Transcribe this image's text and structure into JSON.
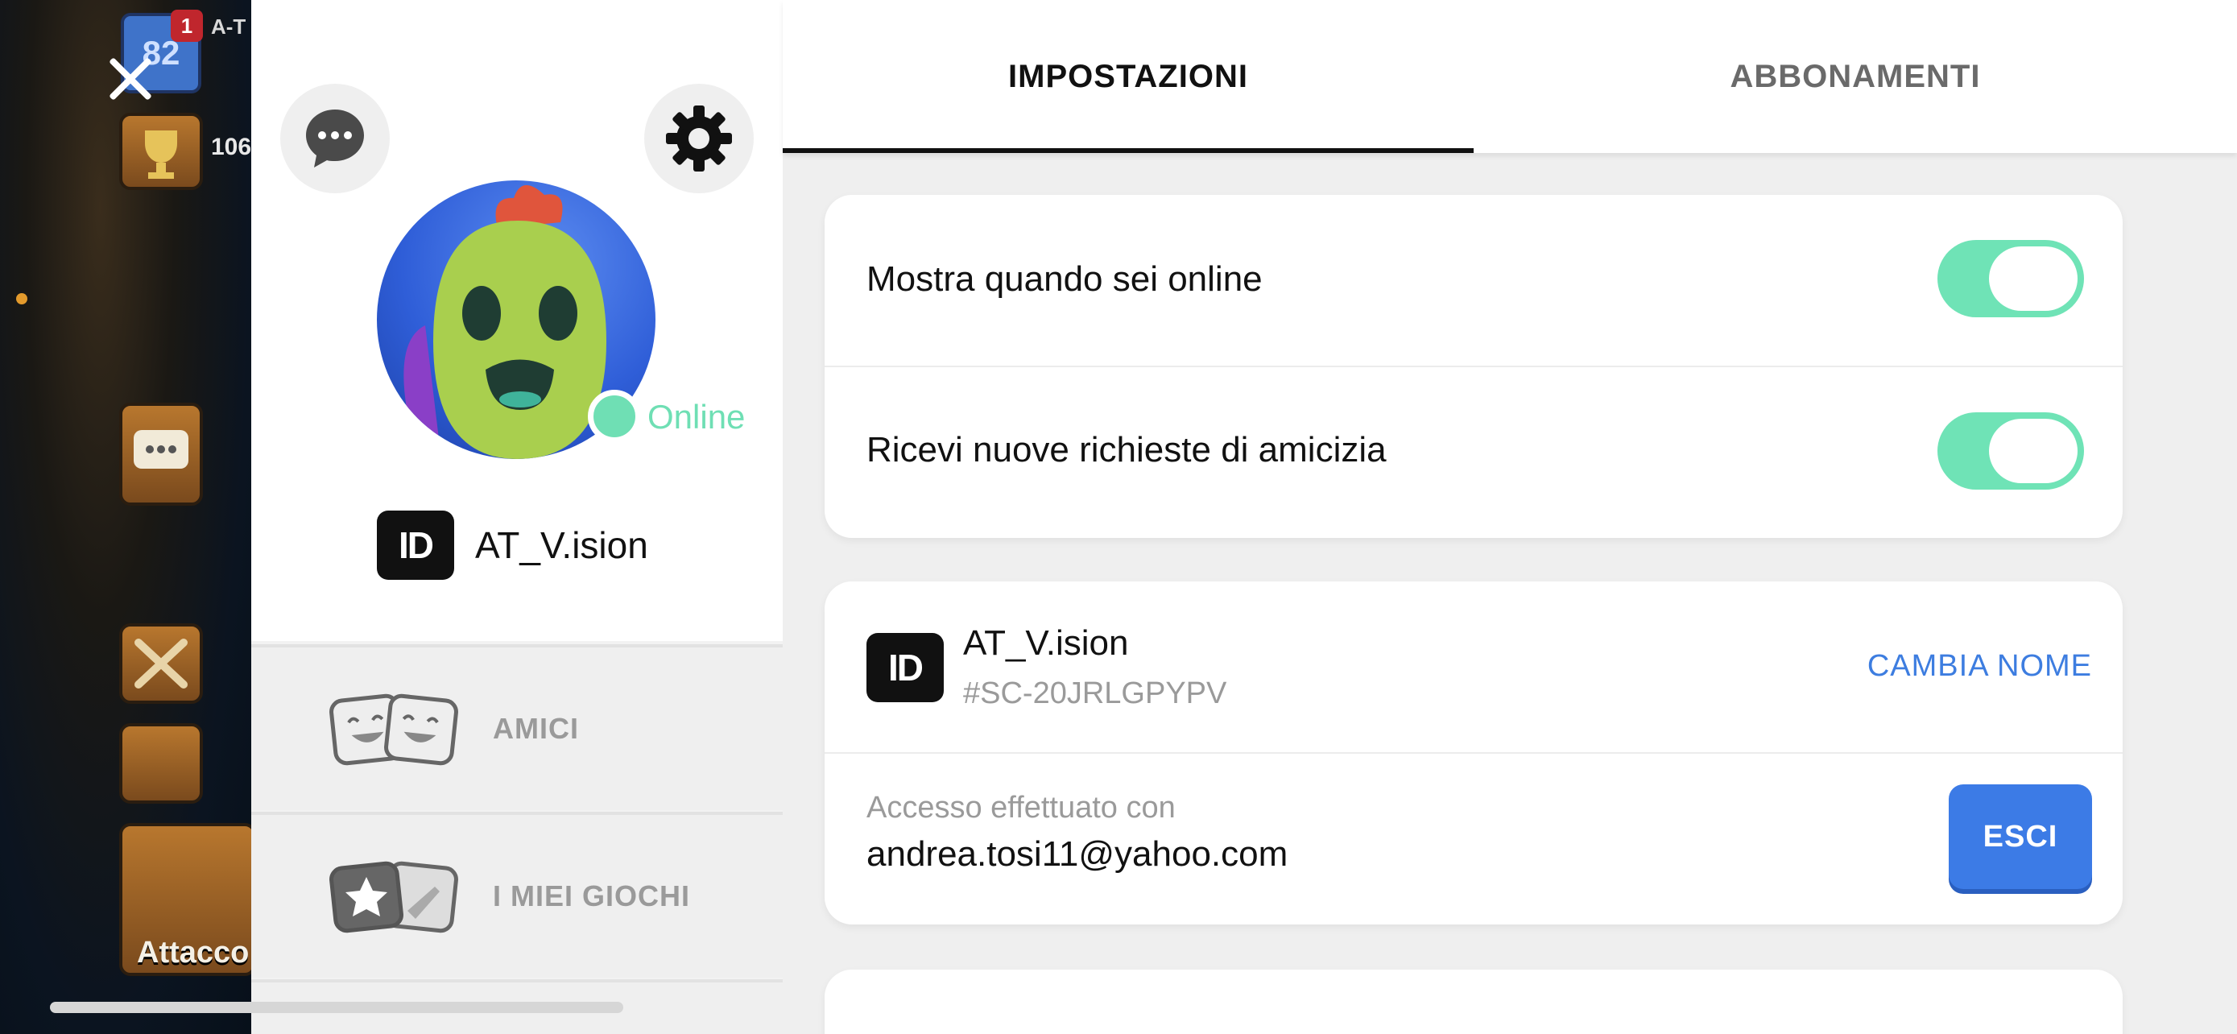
{
  "game": {
    "level": "82",
    "notification_count": "1",
    "player_tag": "A-T",
    "trophies": "106",
    "attack_label": "Attacco"
  },
  "profile": {
    "status_text": "Online",
    "id_badge": "ID",
    "username": "AT_V.ision",
    "menu": [
      {
        "label": "AMICI",
        "icon": "friends-masks-icon"
      },
      {
        "label": "I MIEI GIOCHI",
        "icon": "my-games-icon"
      }
    ]
  },
  "tabs": [
    {
      "label": "IMPOSTAZIONI",
      "active": true
    },
    {
      "label": "ABBONAMENTI",
      "active": false
    }
  ],
  "toggles": [
    {
      "label": "Mostra quando sei online",
      "on": true
    },
    {
      "label": "Ricevi nuove richieste di amicizia",
      "on": true
    }
  ],
  "account": {
    "id_badge": "ID",
    "username": "AT_V.ision",
    "tag": "#SC-20JRLGPYPV",
    "rename_label": "CAMBIA NOME",
    "login_label": "Accesso effettuato con",
    "email": "andrea.tosi11@yahoo.com",
    "logout_label": "ESCI"
  },
  "colors": {
    "accent_green": "#6fe3b6",
    "link_blue": "#3d7de0",
    "button_blue": "#3c7be6"
  }
}
